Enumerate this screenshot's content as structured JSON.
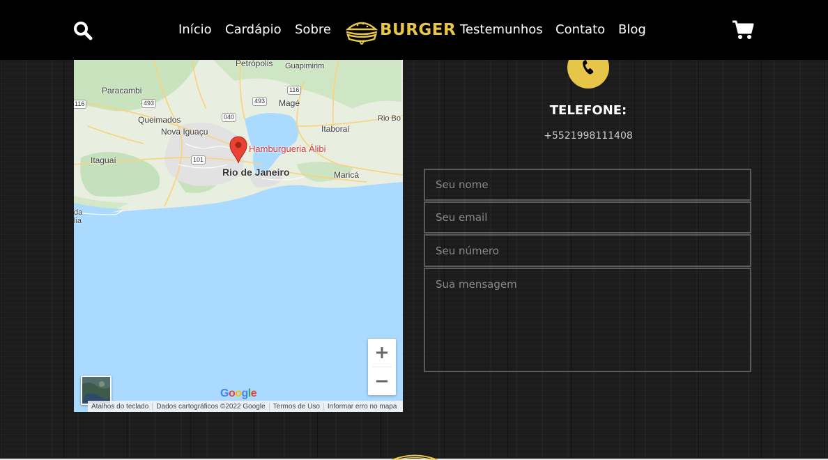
{
  "header": {
    "nav_left": [
      "Início",
      "Cardápio",
      "Sobre"
    ],
    "brand_text": "BURGER",
    "nav_right": [
      "Testemunhos",
      "Contato",
      "Blog"
    ],
    "icons": {
      "search": "search-icon",
      "cart": "cart-icon",
      "logo": "burger-logo-icon"
    },
    "accent_color": "#e7c549"
  },
  "map": {
    "labels": {
      "petropolis": "Petrópolis",
      "guapimirim": "Guapimirim",
      "paracambi": "Paracambi",
      "mage": "Magé",
      "queimados": "Queimados",
      "nova_iguacu": "Nova Iguaçu",
      "itaborai": "Itaboraí",
      "rio_bonito": "Rio Bo",
      "itaguai": "Itaguaí",
      "rio_de_janeiro": "Rio de Janeiro",
      "marica": "Maricá",
      "edge_a": "da",
      "edge_b": "lia"
    },
    "shields": [
      "116",
      "493",
      "493",
      "116",
      "040",
      "101"
    ],
    "place_name": "Hamburgueria Álibi",
    "google": "Google",
    "attribution": [
      "Atalhos do teclado",
      "Dados cartográficos ©2022 Google",
      "Termos de Uso",
      "Informar erro no mapa"
    ]
  },
  "contact": {
    "phone_icon": "phone-icon",
    "telefone_title": "TELEFONE:",
    "telefone_number": "+5521998111408"
  },
  "form": {
    "name_placeholder": "Seu nome",
    "email_placeholder": "Seu email",
    "number_placeholder": "Seu número",
    "message_placeholder": "Sua mensagem"
  }
}
